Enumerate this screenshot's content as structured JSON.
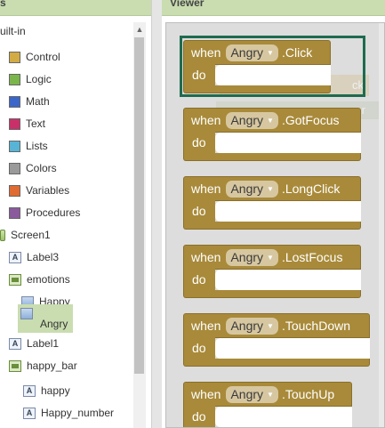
{
  "blocks_panel": {
    "header": "s",
    "root": "uilt-in",
    "builtins": [
      {
        "label": "Control",
        "color": "#d2ab45"
      },
      {
        "label": "Logic",
        "color": "#7ab64b"
      },
      {
        "label": "Math",
        "color": "#3b66c9"
      },
      {
        "label": "Text",
        "color": "#c9306a"
      },
      {
        "label": "Lists",
        "color": "#58b4d6"
      },
      {
        "label": "Colors",
        "color": "#9a9a9a"
      },
      {
        "label": "Variables",
        "color": "#e06b33"
      },
      {
        "label": "Procedures",
        "color": "#8a5a9c"
      }
    ],
    "components": [
      {
        "label": "Screen1",
        "icon": "screen-icon"
      },
      {
        "label": "Label3",
        "icon": "label-icon"
      },
      {
        "label": "emotions",
        "icon": "arrangement-icon"
      },
      {
        "label": "Happy",
        "icon": "image-icon"
      },
      {
        "label": "Angry",
        "icon": "image-icon",
        "selected": true
      },
      {
        "label": "Label1",
        "icon": "label-icon"
      },
      {
        "label": "happy_bar",
        "icon": "arrangement-icon"
      },
      {
        "label": "happy",
        "icon": "label-icon"
      },
      {
        "label": "Happy_number",
        "icon": "label-icon"
      }
    ]
  },
  "viewer": {
    "header": "Viewer",
    "events": [
      {
        "when": "when",
        "component": "Angry",
        "event": ".Click",
        "do": "do"
      },
      {
        "when": "when",
        "component": "Angry",
        "event": ".GotFocus",
        "do": "do"
      },
      {
        "when": "when",
        "component": "Angry",
        "event": ".LongClick",
        "do": "do"
      },
      {
        "when": "when",
        "component": "Angry",
        "event": ".LostFocus",
        "do": "do"
      },
      {
        "when": "when",
        "component": "Angry",
        "event": ".TouchDown",
        "do": "do"
      },
      {
        "when": "when",
        "component": "Angry",
        "event": ".TouchUp",
        "do": "do"
      }
    ],
    "ghosts": [
      "ck",
      "er"
    ]
  }
}
